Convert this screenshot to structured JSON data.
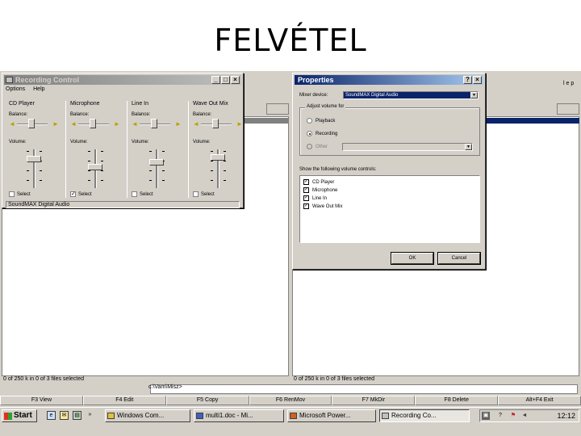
{
  "slide": {
    "title": "FELVÉTEL"
  },
  "file_manager": {
    "left_menu_fragment": "",
    "right_menu_fragment": "l e p",
    "left_status": "0 of 250 k in 0 of 3 files selected",
    "right_status": "0 of 250 k in 0 of 3 files selected",
    "command_path": "c:\\Vam\\Misz>",
    "function_keys": [
      "F3 View",
      "F4 Edit",
      "F5 Copy",
      "F6 RenMov",
      "F7 MkDir",
      "F8 Delete",
      "Alt+F4 Exit"
    ]
  },
  "recording_control": {
    "title": "Recording Control",
    "menu": [
      "Options",
      "Help"
    ],
    "channels": [
      {
        "name": "CD Player",
        "balance_label": "Balance:",
        "volume_label": "Volume:",
        "select_label": "Select",
        "selected": false
      },
      {
        "name": "Microphone",
        "balance_label": "Balance:",
        "volume_label": "Volume:",
        "select_label": "Select",
        "selected": true
      },
      {
        "name": "Line In",
        "balance_label": "Balance:",
        "volume_label": "Volume:",
        "select_label": "Select",
        "selected": false
      },
      {
        "name": "Wave Out Mix",
        "balance_label": "Balance:",
        "volume_label": "Volume:",
        "select_label": "Select",
        "selected": false
      }
    ],
    "status": "SoundMAX Digital Audio"
  },
  "properties": {
    "title": "Properties",
    "mixer_device_label": "Mixer device:",
    "mixer_device_value": "SoundMAX Digital Audio",
    "adjust_group_label": "Adjust volume for",
    "radio_options": [
      {
        "label": "Playback",
        "checked": false,
        "enabled": true
      },
      {
        "label": "Recording",
        "checked": true,
        "enabled": true
      },
      {
        "label": "Other",
        "checked": false,
        "enabled": false
      }
    ],
    "show_controls_label": "Show the following volume controls:",
    "controls": [
      {
        "label": "CD Player",
        "checked": true
      },
      {
        "label": "Microphone",
        "checked": true
      },
      {
        "label": "Line In",
        "checked": true
      },
      {
        "label": "Wave Out Mix",
        "checked": true
      }
    ],
    "ok_label": "OK",
    "cancel_label": "Cancel"
  },
  "taskbar": {
    "start_label": "Start",
    "tasks": [
      {
        "label": "Windows Com...",
        "active": false
      },
      {
        "label": "multi1.doc - Mi...",
        "active": false
      },
      {
        "label": "Microsoft Power...",
        "active": false
      },
      {
        "label": "Recording Co...",
        "active": true
      }
    ],
    "clock": "12:12",
    "icons": {
      "quick_launch": [
        "ie-icon",
        "outlook-icon",
        "desktop-icon"
      ],
      "tray": [
        "network-icon",
        "help-icon",
        "flag-icon",
        "volume-icon"
      ]
    }
  }
}
